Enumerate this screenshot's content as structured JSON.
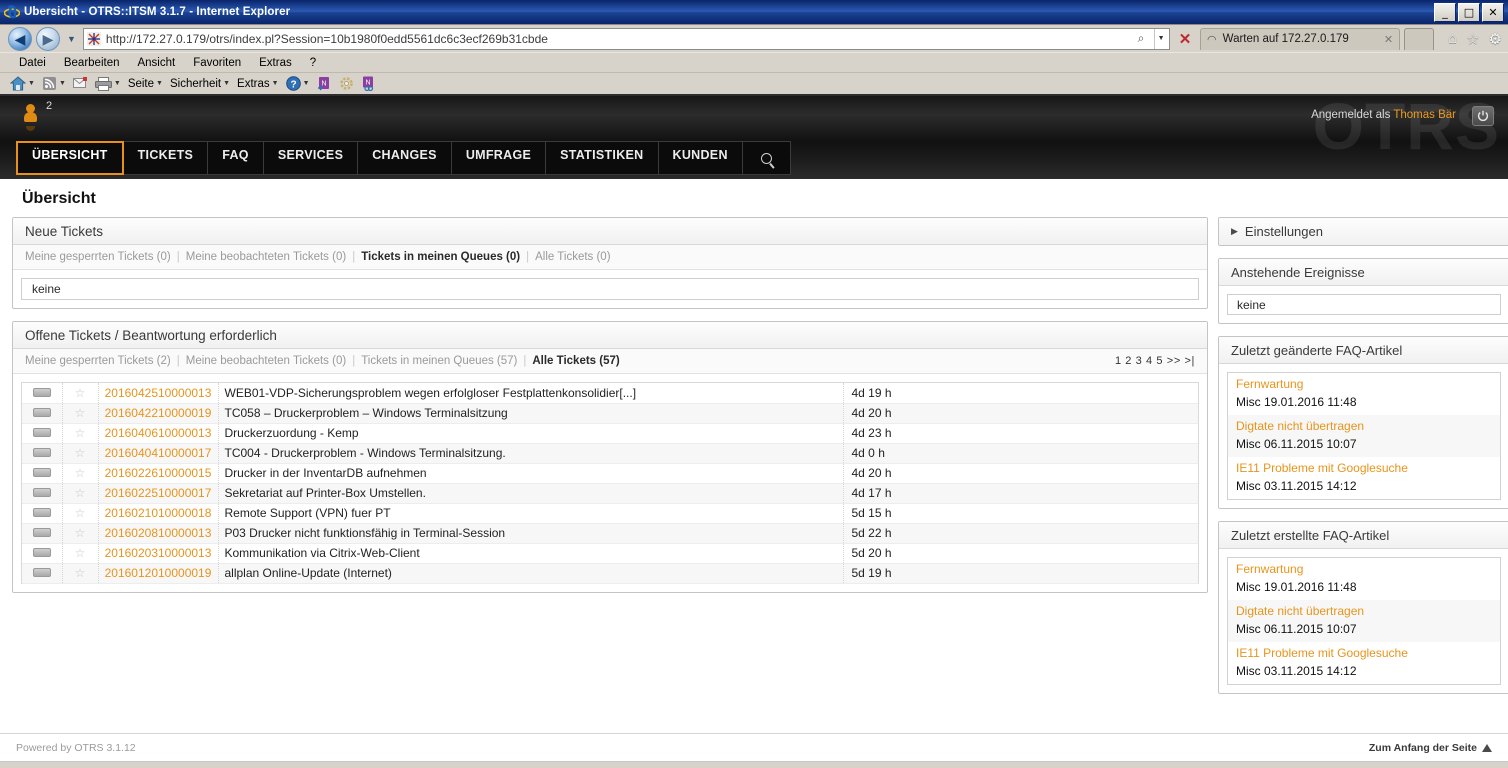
{
  "browser": {
    "window_title": "Übersicht - OTRS::ITSM 3.1.7 - Internet Explorer",
    "url": "http://172.27.0.179/otrs/index.pl?Session=10b1980f0edd5561dc6c3ecf269b31cbde",
    "tab_title": "Warten auf 172.27.0.179",
    "minimize": "_",
    "maximize": "□",
    "close": "✕",
    "menu": [
      "Datei",
      "Bearbeiten",
      "Ansicht",
      "Favoriten",
      "Extras",
      "?"
    ],
    "command_bar": [
      "Seite",
      "Sicherheit",
      "Extras"
    ]
  },
  "otrs_header": {
    "logo_text": "OTRS",
    "notification_count": "2",
    "logged_in_prefix": "Angemeldet als",
    "user_name": "Thomas Bär",
    "nav": [
      {
        "label": "ÜBERSICHT",
        "active": true
      },
      {
        "label": "TICKETS",
        "active": false
      },
      {
        "label": "FAQ",
        "active": false
      },
      {
        "label": "SERVICES",
        "active": false
      },
      {
        "label": "CHANGES",
        "active": false
      },
      {
        "label": "UMFRAGE",
        "active": false
      },
      {
        "label": "STATISTIKEN",
        "active": false
      },
      {
        "label": "KUNDEN",
        "active": false
      }
    ],
    "search_icon": "search-icon"
  },
  "page": {
    "title": "Übersicht"
  },
  "new_tickets": {
    "heading": "Neue Tickets",
    "filters": [
      {
        "label": "Meine gesperrten Tickets (0)",
        "active": false
      },
      {
        "label": "Meine beobachteten Tickets (0)",
        "active": false
      },
      {
        "label": "Tickets in meinen Queues (0)",
        "active": true
      },
      {
        "label": "Alle Tickets (0)",
        "active": false
      }
    ],
    "empty_text": "keine"
  },
  "open_tickets": {
    "heading": "Offene Tickets / Beantwortung erforderlich",
    "filters": [
      {
        "label": "Meine gesperrten Tickets (2)",
        "active": false
      },
      {
        "label": "Meine beobachteten Tickets (0)",
        "active": false
      },
      {
        "label": "Tickets in meinen Queues (57)",
        "active": false
      },
      {
        "label": "Alle Tickets (57)",
        "active": true
      }
    ],
    "pagination": "1 2 3 4 5 >> >|",
    "rows": [
      {
        "number": "2016042510000013",
        "title": "WEB01-VDP-Sicherungsproblem wegen erfolgloser Festplattenkonsolidier[...]",
        "age": "4d 19 h"
      },
      {
        "number": "2016042210000019",
        "title": "TC058 – Druckerproblem – Windows Terminalsitzung",
        "age": "4d 20 h"
      },
      {
        "number": "2016040610000013",
        "title": "Druckerzuordung - Kemp",
        "age": "4d 23 h"
      },
      {
        "number": "2016040410000017",
        "title": "TC004 - Druckerproblem - Windows Terminalsitzung.",
        "age": "4d 0 h"
      },
      {
        "number": "2016022610000015",
        "title": "Drucker in der InventarDB aufnehmen",
        "age": "4d 20 h"
      },
      {
        "number": "2016022510000017",
        "title": "Sekretariat auf Printer-Box Umstellen.",
        "age": "4d 17 h"
      },
      {
        "number": "2016021010000018",
        "title": "Remote Support (VPN) fuer PT",
        "age": "5d 15 h"
      },
      {
        "number": "2016020810000013",
        "title": "P03 Drucker nicht funktionsfähig in Terminal-Session",
        "age": "5d 22 h"
      },
      {
        "number": "2016020310000013",
        "title": "Kommunikation via Citrix-Web-Client",
        "age": "5d 20 h"
      },
      {
        "number": "2016012010000019",
        "title": "allplan Online-Update (Internet)",
        "age": "5d 19 h"
      }
    ]
  },
  "sidebar": {
    "settings": {
      "label": "Einstellungen",
      "icon": "triangle-right-icon"
    },
    "events": {
      "heading": "Anstehende Ereignisse",
      "empty_text": "keine"
    },
    "faq_changed": {
      "heading": "Zuletzt geänderte FAQ-Artikel",
      "items": [
        {
          "title": "Fernwartung",
          "meta": "Misc 19.01.2016 11:48"
        },
        {
          "title": "Digtate nicht übertragen",
          "meta": "Misc 06.11.2015 10:07"
        },
        {
          "title": "IE11 Probleme mit Googlesuche",
          "meta": "Misc 03.11.2015 14:12"
        }
      ]
    },
    "faq_created": {
      "heading": "Zuletzt erstellte FAQ-Artikel",
      "items": [
        {
          "title": "Fernwartung",
          "meta": "Misc 19.01.2016 11:48"
        },
        {
          "title": "Digtate nicht übertragen",
          "meta": "Misc 06.11.2015 10:07"
        },
        {
          "title": "IE11 Probleme mit Googlesuche",
          "meta": "Misc 03.11.2015 14:12"
        }
      ]
    }
  },
  "footer": {
    "powered_by": "Powered by OTRS 3.1.12",
    "top_link": "Zum Anfang der Seite"
  },
  "colors": {
    "accent_orange": "#e8941b",
    "nav_active_border": "#e7911c",
    "titlebar_blue": "#0a246a"
  }
}
